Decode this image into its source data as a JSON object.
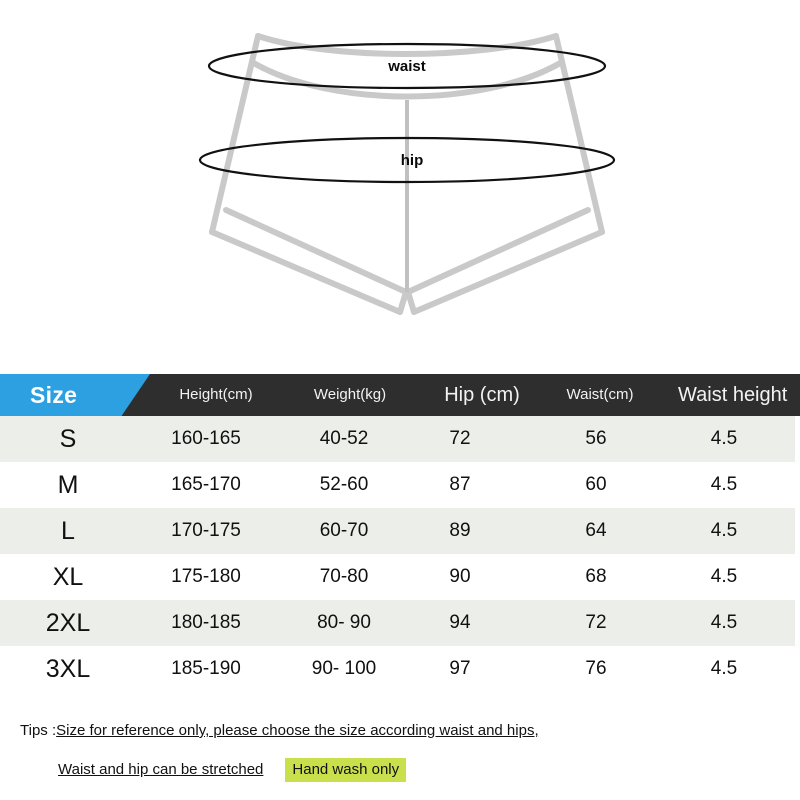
{
  "diagram": {
    "waist_label": "waist",
    "hip_label": "hip"
  },
  "table": {
    "size_header": "Size",
    "headers": [
      "Height(cm)",
      "Weight(kg)",
      "Hip (cm)",
      "Waist(cm)",
      "Waist height"
    ],
    "rows": [
      {
        "size": "S",
        "height": "160-165",
        "weight": "40-52",
        "hip": "72",
        "waist": "56",
        "waist_height": "4.5"
      },
      {
        "size": "M",
        "height": "165-170",
        "weight": "52-60",
        "hip": "87",
        "waist": "60",
        "waist_height": "4.5"
      },
      {
        "size": "L",
        "height": "170-175",
        "weight": "60-70",
        "hip": "89",
        "waist": "64",
        "waist_height": "4.5"
      },
      {
        "size": "XL",
        "height": "175-180",
        "weight": "70-80",
        "hip": "90",
        "waist": "68",
        "waist_height": "4.5"
      },
      {
        "size": "2XL",
        "height": "180-185",
        "weight": "80- 90",
        "hip": "94",
        "waist": "72",
        "waist_height": "4.5"
      },
      {
        "size": "3XL",
        "height": "185-190",
        "weight": "90- 100",
        "hip": "97",
        "waist": "76",
        "waist_height": "4.5"
      }
    ]
  },
  "tips": {
    "prefix": "Tips :",
    "line1": "Size for reference only, please choose the size according waist and hips,",
    "line2": "Waist and hip can be stretched",
    "highlight": "Hand wash only"
  },
  "colors": {
    "accent_blue": "#2ca0e0",
    "header_dark": "#2e2e2e",
    "row_gray": "#eceee9",
    "highlight_green": "#c9e04c",
    "garment_gray": "#c9c9c9"
  }
}
